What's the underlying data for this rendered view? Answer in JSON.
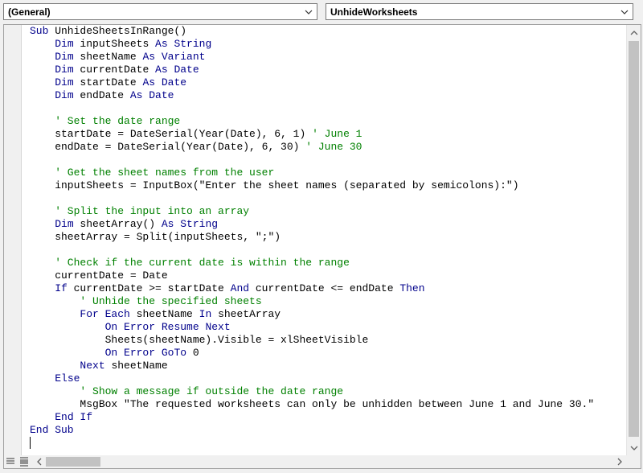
{
  "procedure_dropdown": {
    "value": "(General)"
  },
  "member_dropdown": {
    "value": "UnhideWorksheets"
  },
  "code_lines": [
    [
      {
        "t": "kw",
        "v": "Sub"
      },
      {
        "t": "n",
        "v": " UnhideSheetsInRange()"
      }
    ],
    [
      {
        "t": "n",
        "v": "    "
      },
      {
        "t": "kw",
        "v": "Dim"
      },
      {
        "t": "n",
        "v": " inputSheets "
      },
      {
        "t": "kw",
        "v": "As String"
      }
    ],
    [
      {
        "t": "n",
        "v": "    "
      },
      {
        "t": "kw",
        "v": "Dim"
      },
      {
        "t": "n",
        "v": " sheetName "
      },
      {
        "t": "kw",
        "v": "As Variant"
      }
    ],
    [
      {
        "t": "n",
        "v": "    "
      },
      {
        "t": "kw",
        "v": "Dim"
      },
      {
        "t": "n",
        "v": " currentDate "
      },
      {
        "t": "kw",
        "v": "As Date"
      }
    ],
    [
      {
        "t": "n",
        "v": "    "
      },
      {
        "t": "kw",
        "v": "Dim"
      },
      {
        "t": "n",
        "v": " startDate "
      },
      {
        "t": "kw",
        "v": "As Date"
      }
    ],
    [
      {
        "t": "n",
        "v": "    "
      },
      {
        "t": "kw",
        "v": "Dim"
      },
      {
        "t": "n",
        "v": " endDate "
      },
      {
        "t": "kw",
        "v": "As Date"
      }
    ],
    [],
    [
      {
        "t": "cm",
        "v": "    ' Set the date range"
      }
    ],
    [
      {
        "t": "n",
        "v": "    startDate = DateSerial(Year(Date), 6, 1) "
      },
      {
        "t": "cm",
        "v": "' June 1"
      }
    ],
    [
      {
        "t": "n",
        "v": "    endDate = DateSerial(Year(Date), 6, 30) "
      },
      {
        "t": "cm",
        "v": "' June 30"
      }
    ],
    [],
    [
      {
        "t": "cm",
        "v": "    ' Get the sheet names from the user"
      }
    ],
    [
      {
        "t": "n",
        "v": "    inputSheets = InputBox(\"Enter the sheet names (separated by semicolons):\")"
      }
    ],
    [],
    [
      {
        "t": "cm",
        "v": "    ' Split the input into an array"
      }
    ],
    [
      {
        "t": "n",
        "v": "    "
      },
      {
        "t": "kw",
        "v": "Dim"
      },
      {
        "t": "n",
        "v": " sheetArray() "
      },
      {
        "t": "kw",
        "v": "As String"
      }
    ],
    [
      {
        "t": "n",
        "v": "    sheetArray = Split(inputSheets, \";\")"
      }
    ],
    [],
    [
      {
        "t": "cm",
        "v": "    ' Check if the current date is within the range"
      }
    ],
    [
      {
        "t": "n",
        "v": "    currentDate = Date"
      }
    ],
    [
      {
        "t": "n",
        "v": "    "
      },
      {
        "t": "kw",
        "v": "If"
      },
      {
        "t": "n",
        "v": " currentDate >= startDate "
      },
      {
        "t": "kw",
        "v": "And"
      },
      {
        "t": "n",
        "v": " currentDate <= endDate "
      },
      {
        "t": "kw",
        "v": "Then"
      }
    ],
    [
      {
        "t": "cm",
        "v": "        ' Unhide the specified sheets"
      }
    ],
    [
      {
        "t": "n",
        "v": "        "
      },
      {
        "t": "kw",
        "v": "For Each"
      },
      {
        "t": "n",
        "v": " sheetName "
      },
      {
        "t": "kw",
        "v": "In"
      },
      {
        "t": "n",
        "v": " sheetArray"
      }
    ],
    [
      {
        "t": "n",
        "v": "            "
      },
      {
        "t": "kw",
        "v": "On Error Resume Next"
      }
    ],
    [
      {
        "t": "n",
        "v": "            Sheets(sheetName).Visible = xlSheetVisible"
      }
    ],
    [
      {
        "t": "n",
        "v": "            "
      },
      {
        "t": "kw",
        "v": "On Error GoTo"
      },
      {
        "t": "n",
        "v": " 0"
      }
    ],
    [
      {
        "t": "n",
        "v": "        "
      },
      {
        "t": "kw",
        "v": "Next"
      },
      {
        "t": "n",
        "v": " sheetName"
      }
    ],
    [
      {
        "t": "n",
        "v": "    "
      },
      {
        "t": "kw",
        "v": "Else"
      }
    ],
    [
      {
        "t": "cm",
        "v": "        ' Show a message if outside the date range"
      }
    ],
    [
      {
        "t": "n",
        "v": "        MsgBox \"The requested worksheets can only be unhidden between June 1 and June 30.\""
      }
    ],
    [
      {
        "t": "n",
        "v": "    "
      },
      {
        "t": "kw",
        "v": "End If"
      }
    ],
    [
      {
        "t": "kw",
        "v": "End Sub"
      }
    ]
  ],
  "colors": {
    "keyword": "#00008b",
    "comment": "#008000",
    "text": "#000000"
  },
  "icons": [
    "chevron-down-icon",
    "procedure-view-icon",
    "full-module-view-icon",
    "arrow-up-icon",
    "arrow-down-icon",
    "arrow-left-icon",
    "arrow-right-icon"
  ]
}
